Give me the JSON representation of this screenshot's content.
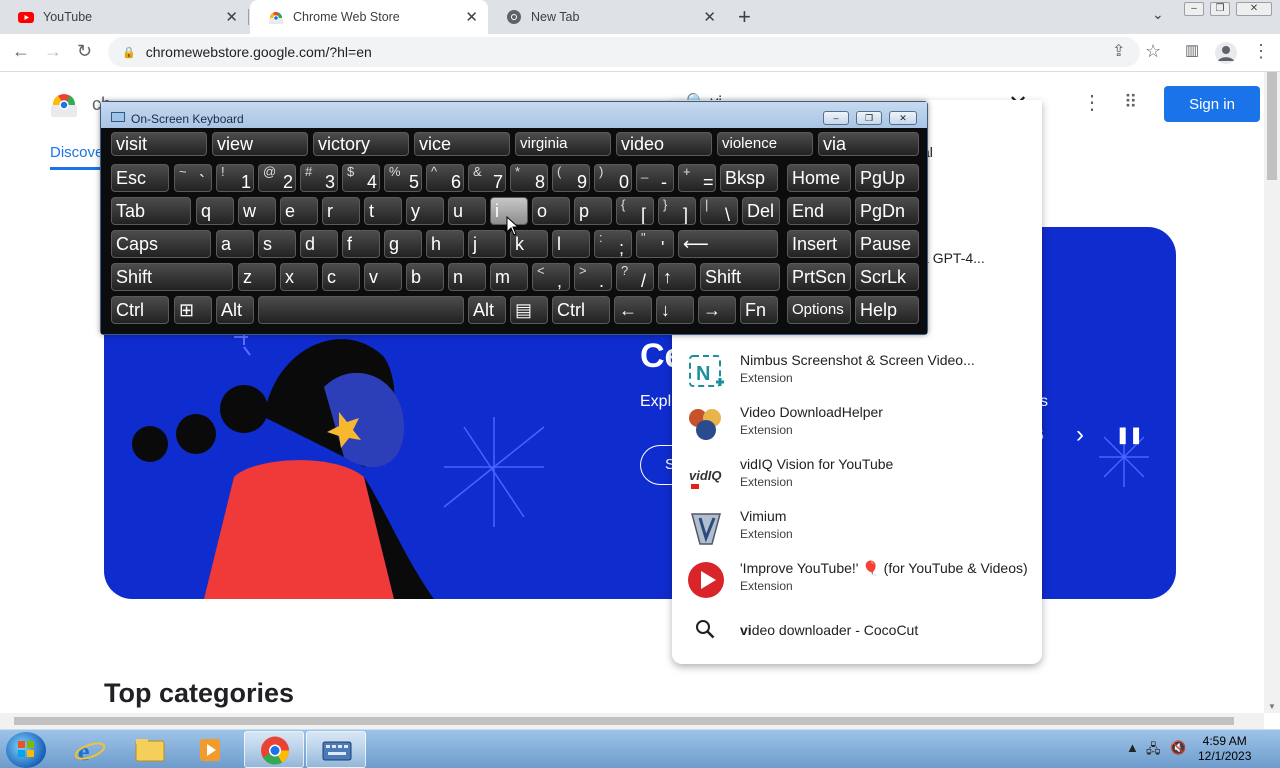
{
  "browser": {
    "tabs": [
      {
        "title": "YouTube",
        "icon": "youtube-icon"
      },
      {
        "title": "Chrome Web Store",
        "icon": "chrome-web-store-icon"
      },
      {
        "title": "New Tab",
        "icon": "chrome-icon"
      }
    ],
    "address": "chromewebstore.google.com/?hl=en"
  },
  "page": {
    "store_name_fragment": "ch",
    "search_query_fragment": "vi",
    "discover_tab": "Discove",
    "sign_in": "Sign in",
    "top_categories": "Top categories",
    "banner": {
      "title_fragment": "Ce",
      "subtitle_fragment": "Expl",
      "subtitle_tail": "s",
      "button_fragment": "S",
      "counter_fragment": "5"
    }
  },
  "dropdown": {
    "partial_fragments": [
      {
        "text": "al"
      },
      {
        "text": "on & GPT-4..."
      }
    ],
    "items": [
      {
        "title": "Nimbus Screenshot & Screen Video...",
        "subtitle": "Extension",
        "icon": "nimbus-icon"
      },
      {
        "title": "Video DownloadHelper",
        "subtitle": "Extension",
        "icon": "video-downloadhelper-icon"
      },
      {
        "title": "vidIQ Vision for YouTube",
        "subtitle": "Extension",
        "icon": "vidiq-icon"
      },
      {
        "title": "Vimium",
        "subtitle": "Extension",
        "icon": "vimium-icon"
      },
      {
        "title": "'Improve YouTube!' 🎈 (for YouTube & Videos)",
        "subtitle": "Extension",
        "icon": "improve-youtube-icon"
      }
    ],
    "suggestion": {
      "bold": "vi",
      "rest": "deo downloader - CocoCut"
    }
  },
  "osk": {
    "title": "On-Screen Keyboard",
    "predictions": [
      "visit",
      "view",
      "victory",
      "vice",
      "virginia",
      "video",
      "violence",
      "via"
    ],
    "rows": [
      [
        {
          "l": "Esc"
        },
        {
          "s": "~",
          "m": "`"
        },
        {
          "s": "!",
          "m": "1"
        },
        {
          "s": "@",
          "m": "2"
        },
        {
          "s": "#",
          "m": "3"
        },
        {
          "s": "$",
          "m": "4"
        },
        {
          "s": "%",
          "m": "5"
        },
        {
          "s": "^",
          "m": "6"
        },
        {
          "s": "&",
          "m": "7"
        },
        {
          "s": "*",
          "m": "8"
        },
        {
          "s": "(",
          "m": "9"
        },
        {
          "s": ")",
          "m": "0"
        },
        {
          "s": "_",
          "m": "-"
        },
        {
          "s": "+",
          "m": "="
        },
        {
          "l": "Bksp"
        },
        {
          "l": "Home"
        },
        {
          "l": "PgUp"
        }
      ],
      [
        {
          "l": "Tab"
        },
        {
          "l": "q"
        },
        {
          "l": "w"
        },
        {
          "l": "e"
        },
        {
          "l": "r"
        },
        {
          "l": "t"
        },
        {
          "l": "y"
        },
        {
          "l": "u"
        },
        {
          "l": "i"
        },
        {
          "l": "o"
        },
        {
          "l": "p"
        },
        {
          "s": "{",
          "m": "["
        },
        {
          "s": "}",
          "m": "]"
        },
        {
          "s": "|",
          "m": "\\"
        },
        {
          "l": "Del"
        },
        {
          "l": "End"
        },
        {
          "l": "PgDn"
        }
      ],
      [
        {
          "l": "Caps"
        },
        {
          "l": "a"
        },
        {
          "l": "s"
        },
        {
          "l": "d"
        },
        {
          "l": "f"
        },
        {
          "l": "g"
        },
        {
          "l": "h"
        },
        {
          "l": "j"
        },
        {
          "l": "k"
        },
        {
          "l": "l"
        },
        {
          "s": ":",
          "m": ";"
        },
        {
          "s": "\"",
          "m": "'"
        },
        {
          "l": "⟵"
        },
        {
          "l": "Insert"
        },
        {
          "l": "Pause"
        }
      ],
      [
        {
          "l": "Shift"
        },
        {
          "l": "z"
        },
        {
          "l": "x"
        },
        {
          "l": "c"
        },
        {
          "l": "v"
        },
        {
          "l": "b"
        },
        {
          "l": "n"
        },
        {
          "l": "m"
        },
        {
          "s": "<",
          "m": ","
        },
        {
          "s": ">",
          "m": "."
        },
        {
          "s": "?",
          "m": "/"
        },
        {
          "l": "↑"
        },
        {
          "l": "Shift"
        },
        {
          "l": "PrtScn"
        },
        {
          "l": "ScrLk"
        }
      ],
      [
        {
          "l": "Ctrl"
        },
        {
          "l": "⊞"
        },
        {
          "l": "Alt"
        },
        {
          "l": ""
        },
        {
          "l": "Alt"
        },
        {
          "l": "▤"
        },
        {
          "l": "Ctrl"
        },
        {
          "l": "←"
        },
        {
          "l": "↓"
        },
        {
          "l": "→"
        },
        {
          "l": "Fn"
        },
        {
          "l": "Options"
        },
        {
          "l": "Help"
        }
      ]
    ],
    "highlighted_key": "i"
  },
  "taskbar": {
    "time": "4:59 AM",
    "date": "12/1/2023"
  }
}
